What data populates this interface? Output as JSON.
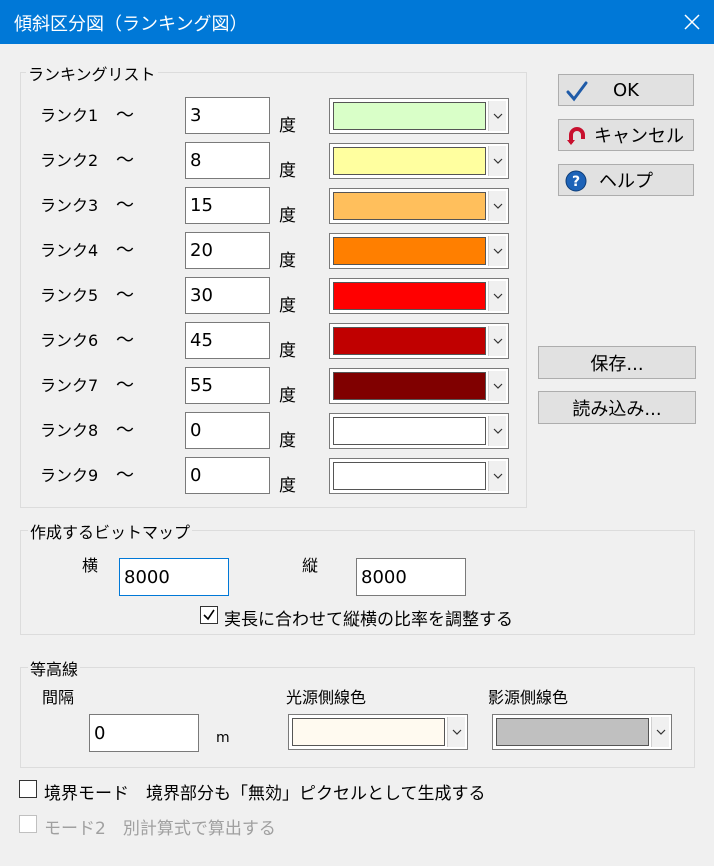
{
  "window": {
    "title": "傾斜区分図（ランキング図）"
  },
  "ranking": {
    "group_title": "ランキングリスト",
    "tilde": "～",
    "unit": "度",
    "rows": [
      {
        "label": "ランク1",
        "value": "3",
        "color": "#d9ffc8"
      },
      {
        "label": "ランク2",
        "value": "8",
        "color": "#ffff9f"
      },
      {
        "label": "ランク3",
        "value": "15",
        "color": "#ffbf5c"
      },
      {
        "label": "ランク4",
        "value": "20",
        "color": "#ff7f00"
      },
      {
        "label": "ランク5",
        "value": "30",
        "color": "#ff0000"
      },
      {
        "label": "ランク6",
        "value": "45",
        "color": "#c00000"
      },
      {
        "label": "ランク7",
        "value": "55",
        "color": "#800000"
      },
      {
        "label": "ランク8",
        "value": "0",
        "color": "#ffffff"
      },
      {
        "label": "ランク9",
        "value": "0",
        "color": "#ffffff"
      }
    ]
  },
  "buttons": {
    "ok": "OK",
    "cancel": "キャンセル",
    "help": "ヘルプ",
    "save": "保存...",
    "load": "読み込み..."
  },
  "bitmap": {
    "group_title": "作成するビットマップ",
    "width_label": "横",
    "width_value": "8000",
    "height_label": "縦",
    "height_value": "8000",
    "aspect_label": "実長に合わせて縦横の比率を調整する",
    "aspect_checked": true
  },
  "contour": {
    "group_title": "等高線",
    "interval_label": "間隔",
    "interval_value": "0",
    "interval_unit": "m",
    "light_label": "光源側線色",
    "light_color": "#fffaf0",
    "shadow_label": "影源側線色",
    "shadow_color": "#c0c0c0"
  },
  "options": {
    "boundary_label": "境界モード　境界部分も「無効」ピクセルとして生成する",
    "boundary_checked": false,
    "mode2_label": "モード2　別計算式で算出する",
    "mode2_checked": false,
    "mode2_enabled": false
  },
  "colors": {
    "titlebar": "#0078d7",
    "check_blue": "#1f5ba8",
    "cancel_red": "#c8102e",
    "help_blue": "#1d63b8"
  }
}
